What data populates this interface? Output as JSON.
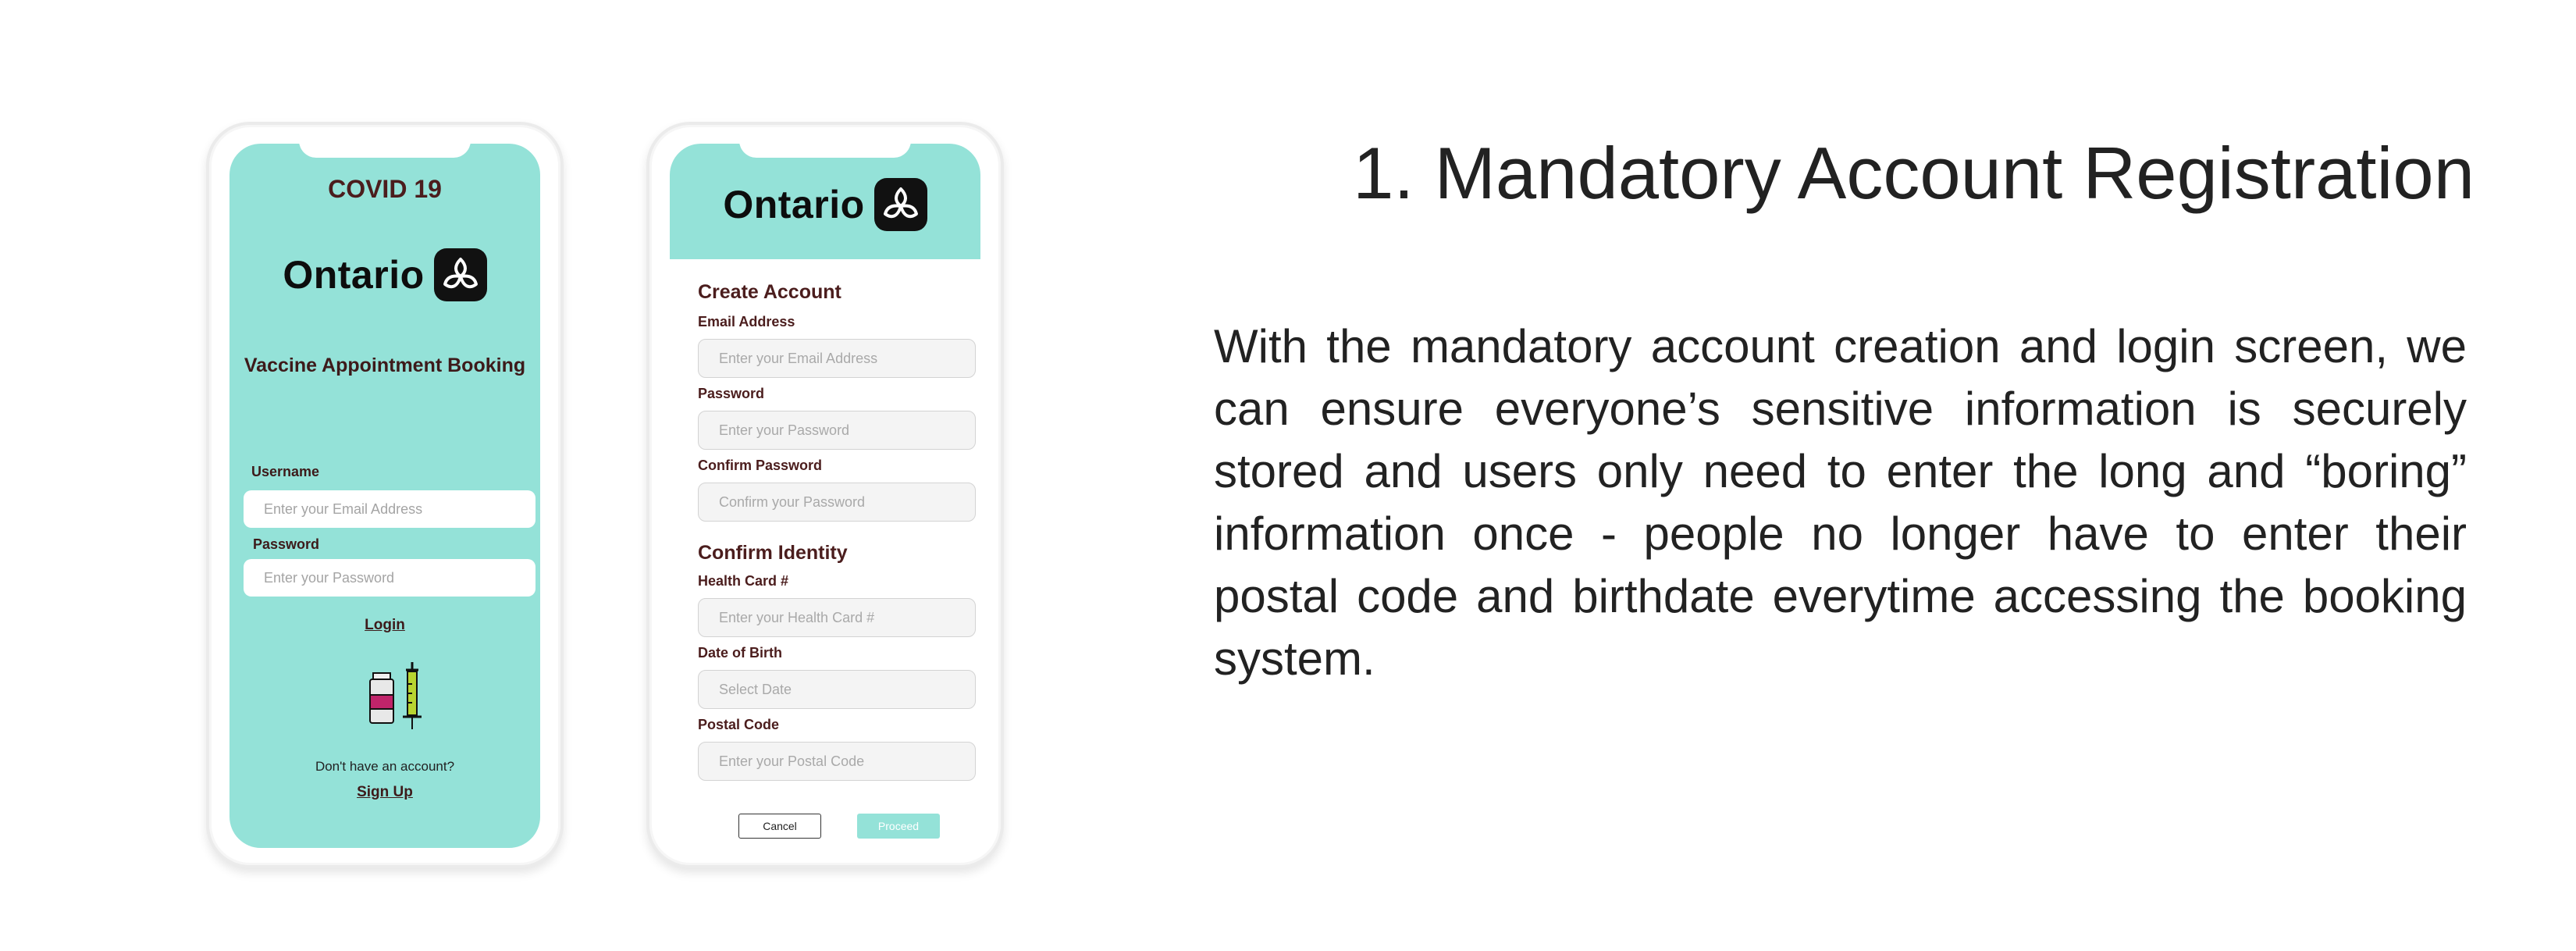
{
  "login_screen": {
    "title": "COVID 19",
    "brand": "Ontario",
    "subtitle": "Vaccine Appointment Booking",
    "username_label": "Username",
    "username_placeholder": "Enter your Email Address",
    "password_label": "Password",
    "password_placeholder": "Enter your Password",
    "login_link": "Login",
    "no_account_text": "Don't have an account?",
    "signup_link": "Sign Up"
  },
  "signup_screen": {
    "brand": "Ontario",
    "create_account_title": "Create Account",
    "email_label": "Email Address",
    "email_placeholder": "Enter your Email Address",
    "password_label": "Password",
    "password_placeholder": "Enter your Password",
    "confirm_password_label": "Confirm Password",
    "confirm_password_placeholder": "Confirm your Password",
    "confirm_identity_title": "Confirm Identity",
    "health_card_label": "Health Card #",
    "health_card_placeholder": "Enter your Health Card #",
    "dob_label": "Date of Birth",
    "dob_placeholder": "Select Date",
    "postal_label": "Postal Code",
    "postal_placeholder": "Enter your Postal Code",
    "cancel_button": "Cancel",
    "proceed_button": "Proceed"
  },
  "description": {
    "heading": "1. Mandatory Account Registration",
    "body": "With the mandatory account creation and login screen, we can ensure everyone’s sensitive information is securely stored and users only need to enter the long and “boring” information once - people no longer have to enter their postal code and birthdate everytime accessing the booking system."
  },
  "colors": {
    "accent_teal": "#94e2d8",
    "dark_maroon": "#4b1d1d",
    "text_dark": "#222222"
  },
  "icons": [
    "ontario-trillium-icon",
    "vaccine-vial-icon",
    "syringe-icon"
  ]
}
